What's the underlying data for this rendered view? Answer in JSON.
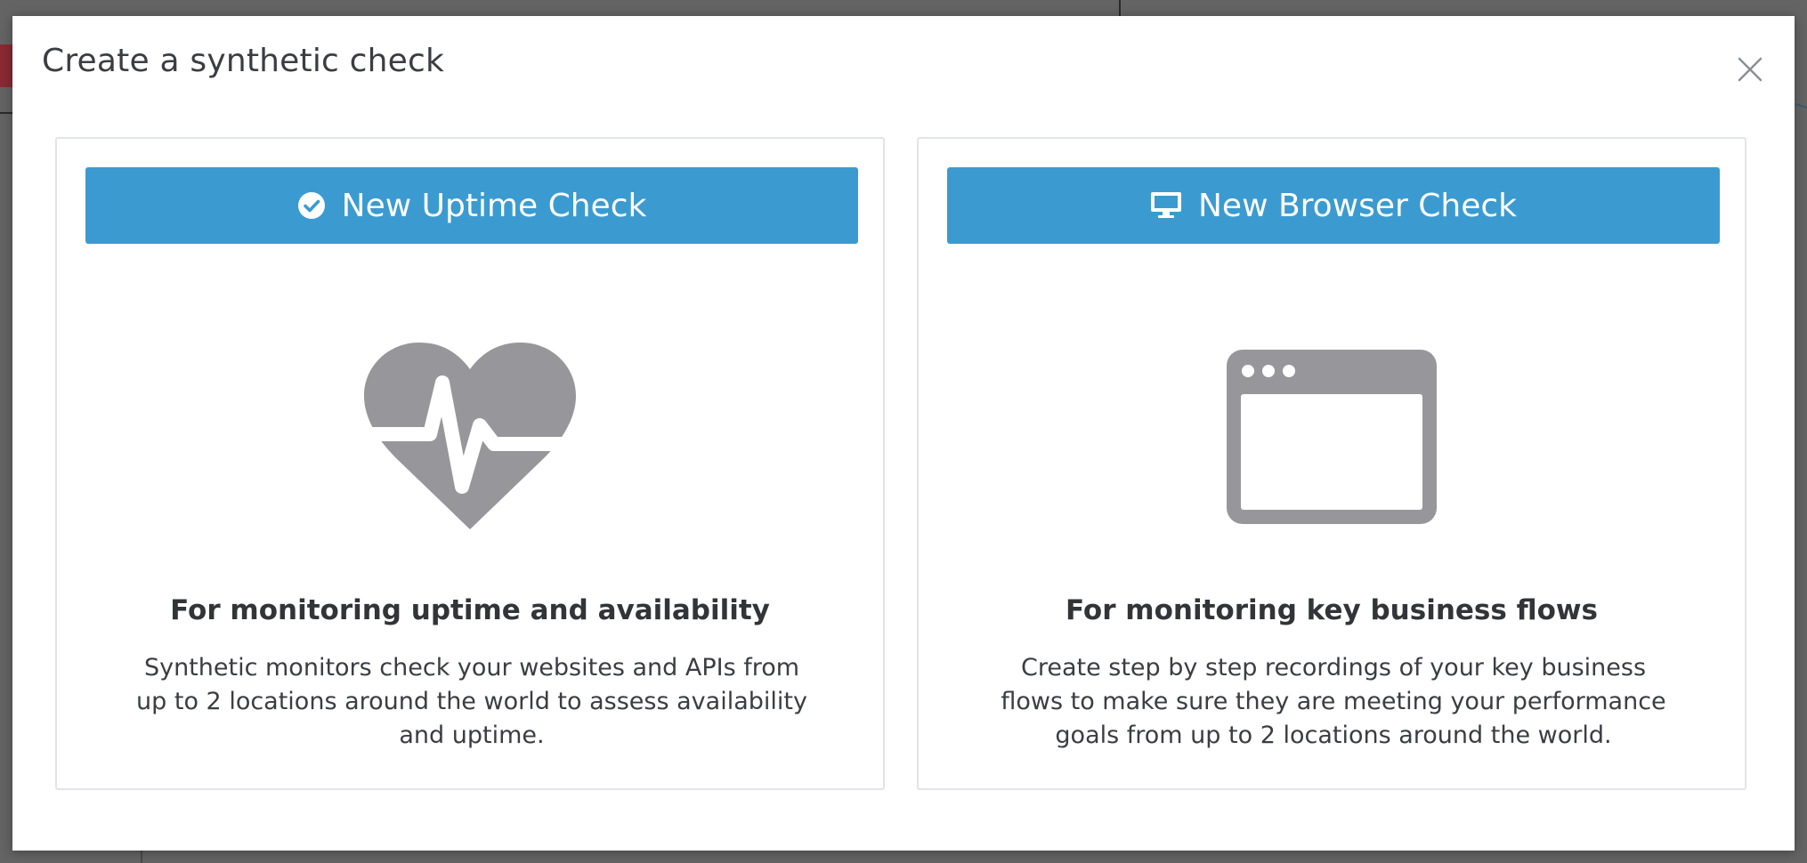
{
  "modal": {
    "title": "Create a synthetic check",
    "close_icon": "close-icon"
  },
  "cards": {
    "uptime": {
      "button_label": "New Uptime Check",
      "button_icon": "check-circle-icon",
      "illustration": "heart-pulse-icon",
      "heading": "For monitoring uptime and availability",
      "description": "Synthetic monitors check your websites and APIs from up to 2 locations around the world to assess availability and uptime."
    },
    "browser": {
      "button_label": "New Browser Check",
      "button_icon": "monitor-icon",
      "illustration": "browser-window-icon",
      "heading": "For monitoring key business flows",
      "description": "Create step by step recordings of your key business flows to make sure they are meeting your performance goals from up to 2 locations around the world."
    }
  },
  "colors": {
    "accent": "#3b9bd0",
    "illustration_gray": "#97969b",
    "overlay": "#646464"
  }
}
